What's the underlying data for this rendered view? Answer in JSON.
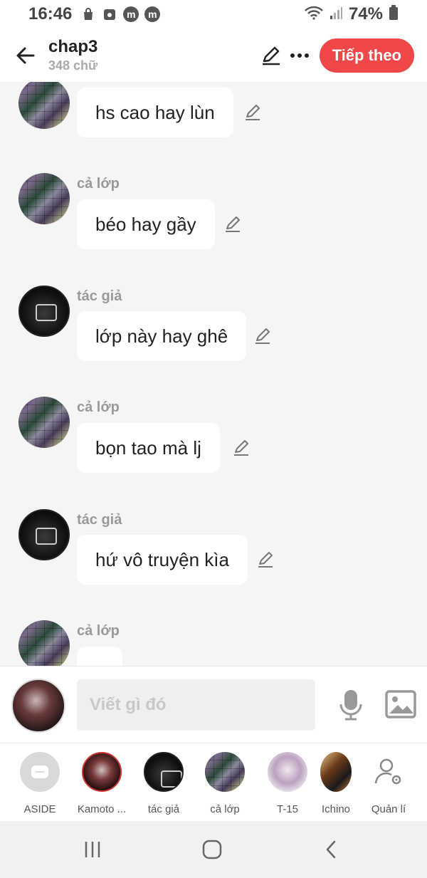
{
  "status_bar": {
    "time": "16:46",
    "icons": [
      "shopping-bag-icon",
      "calendar-app-icon",
      "m-app-icon",
      "m-app-icon"
    ],
    "m_glyph": "m",
    "battery": "74%"
  },
  "header": {
    "title": "chap3",
    "subtitle": "348 chữ",
    "next_button": "Tiếp theo"
  },
  "messages": [
    {
      "sender": "",
      "role": "class",
      "text": "hs cao hay lùn"
    },
    {
      "sender": "cả lớp",
      "role": "class",
      "text": "béo hay gầy"
    },
    {
      "sender": "tác giả",
      "role": "author",
      "text": "lớp này hay ghê"
    },
    {
      "sender": "cả lớp",
      "role": "class",
      "text": "bọn tao mà lj"
    },
    {
      "sender": "tác giả",
      "role": "author",
      "text": "hứ vô truyện kìa"
    },
    {
      "sender": "cả lớp",
      "role": "class",
      "text": ""
    }
  ],
  "input": {
    "placeholder": "Viết gì đó"
  },
  "characters": [
    {
      "label": "ASIDE"
    },
    {
      "label": "Kamoto ..."
    },
    {
      "label": "tác giả"
    },
    {
      "label": "cả lớp"
    },
    {
      "label": "T-15"
    },
    {
      "label": "Ichino"
    },
    {
      "label": "Quản lí"
    }
  ],
  "colors": {
    "accent": "#f04848",
    "background": "#f5f5f5",
    "sender_text": "#999999"
  }
}
